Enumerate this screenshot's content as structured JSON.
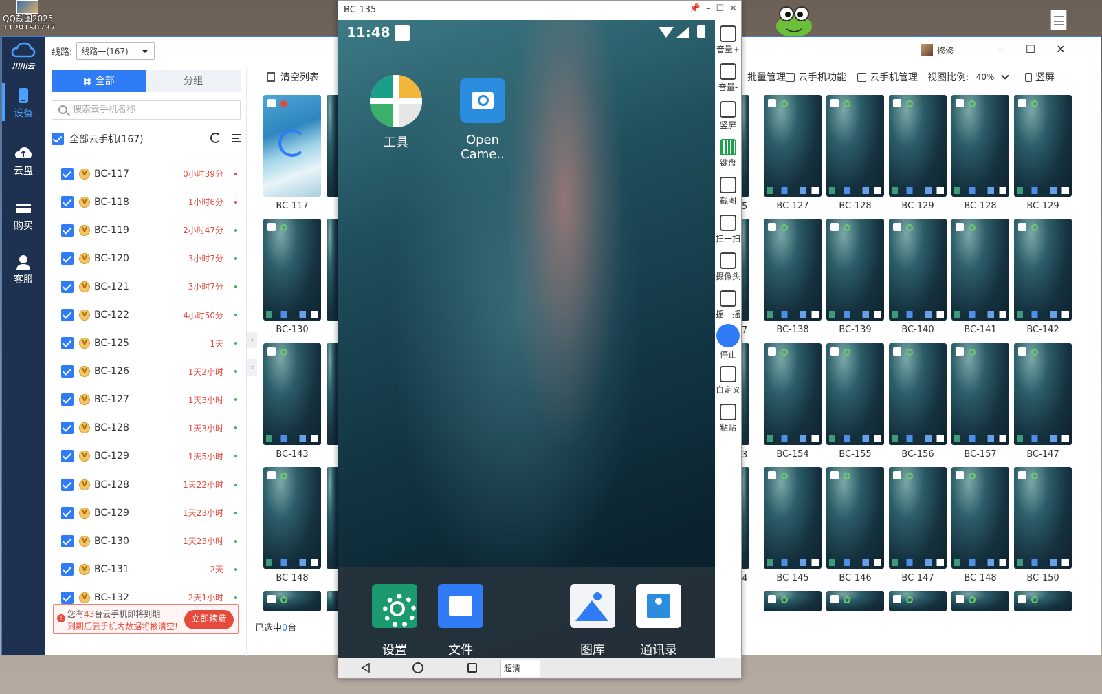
{
  "desktop": {
    "icon_caption": "QQ截图2025",
    "icon_caption2": "1129150737"
  },
  "app": {
    "logo_text": "川川云",
    "rail": [
      {
        "label": "设备",
        "icon": "phone-icon",
        "active": true
      },
      {
        "label": "云盘",
        "icon": "cloud-upload-icon",
        "active": false
      },
      {
        "label": "购买",
        "icon": "cart-icon",
        "active": false
      },
      {
        "label": "客服",
        "icon": "support-icon",
        "active": false
      }
    ],
    "route_label": "线路:",
    "route_value": "线路一(167)",
    "tabs": [
      "全部",
      "分组"
    ],
    "search_placeholder": "搜索云手机名称",
    "all_label": "全部云手机(167)",
    "devices": [
      {
        "name": "BC-117",
        "time": "0小时39分",
        "dot": "red"
      },
      {
        "name": "BC-118",
        "time": "1小时6分",
        "dot": "red"
      },
      {
        "name": "BC-119",
        "time": "2小时47分",
        "dot": "green"
      },
      {
        "name": "BC-120",
        "time": "3小时7分",
        "dot": "green"
      },
      {
        "name": "BC-121",
        "time": "3小时7分",
        "dot": "green"
      },
      {
        "name": "BC-122",
        "time": "4小时50分",
        "dot": "green"
      },
      {
        "name": "BC-125",
        "time": "1天",
        "dot": "green"
      },
      {
        "name": "BC-126",
        "time": "1天2小时",
        "dot": "green"
      },
      {
        "name": "BC-127",
        "time": "1天3小时",
        "dot": "green"
      },
      {
        "name": "BC-128",
        "time": "1天3小时",
        "dot": "green"
      },
      {
        "name": "BC-129",
        "time": "1天5小时",
        "dot": "green"
      },
      {
        "name": "BC-128",
        "time": "1天22小时",
        "dot": "green"
      },
      {
        "name": "BC-129",
        "time": "1天23小时",
        "dot": "green"
      },
      {
        "name": "BC-130",
        "time": "1天23小时",
        "dot": "green"
      },
      {
        "name": "BC-131",
        "time": "2天",
        "dot": "green"
      },
      {
        "name": "BC-132",
        "time": "2天1小时",
        "dot": "green"
      }
    ],
    "warning": {
      "line1_pre": "您有",
      "line1_num": "43",
      "line1_post": "台云手机即将到期",
      "line2": "到期后云手机内数据将被清空!",
      "button": "立即续费"
    },
    "clear_list": "清空列表",
    "selected_pre": "已选中",
    "selected_num": "0",
    "selected_post": "台",
    "left_grid": [
      [
        "BC-117",
        "BC-130",
        "BC-143",
        "BC-148"
      ]
    ],
    "right_title": "修修",
    "right_toolbar": {
      "batch": "批量管理",
      "functions": "云手机功能",
      "manage": "云手机管理",
      "ratio_label": "视图比例:",
      "ratio_value": "40%",
      "portrait": "竖屏"
    },
    "right_grid": [
      [
        "BC-127",
        "BC-128",
        "BC-129",
        "BC-128",
        "BC-129"
      ],
      [
        "BC-138",
        "BC-139",
        "BC-140",
        "BC-141",
        "BC-142"
      ],
      [
        "BC-154",
        "BC-155",
        "BC-156",
        "BC-157",
        "BC-147"
      ],
      [
        "BC-145",
        "BC-146",
        "BC-147",
        "BC-148",
        "BC-150"
      ]
    ],
    "right_partial_caps": [
      "5",
      "7",
      "3",
      "4"
    ]
  },
  "phone": {
    "title": "BC-135",
    "time": "11:48",
    "apps": [
      {
        "label": "工具",
        "icon": "tools-folder-icon"
      },
      {
        "label": "Open Came..",
        "icon": "camera-icon"
      }
    ],
    "dock": [
      {
        "label": "设置",
        "icon": "settings-icon"
      },
      {
        "label": "文件",
        "icon": "files-icon"
      },
      {
        "label": "图库",
        "icon": "gallery-icon"
      },
      {
        "label": "通讯录",
        "icon": "contacts-icon"
      }
    ],
    "quality": "超清",
    "tools": [
      {
        "label": "音量+",
        "icon": "volume-up-icon"
      },
      {
        "label": "音量-",
        "icon": "volume-down-icon"
      },
      {
        "label": "竖屏",
        "icon": "rotate-icon"
      },
      {
        "label": "键盘",
        "icon": "keyboard-icon"
      },
      {
        "label": "截图",
        "icon": "screenshot-icon"
      },
      {
        "label": "扫一扫",
        "icon": "scan-icon"
      },
      {
        "label": "摄像头",
        "icon": "camera-lens-icon"
      },
      {
        "label": "摇一摇",
        "icon": "shake-icon"
      },
      {
        "label": "停止",
        "icon": "pause-icon"
      },
      {
        "label": "自定义",
        "icon": "custom-icon"
      },
      {
        "label": "粘贴",
        "icon": "paste-icon"
      }
    ]
  }
}
